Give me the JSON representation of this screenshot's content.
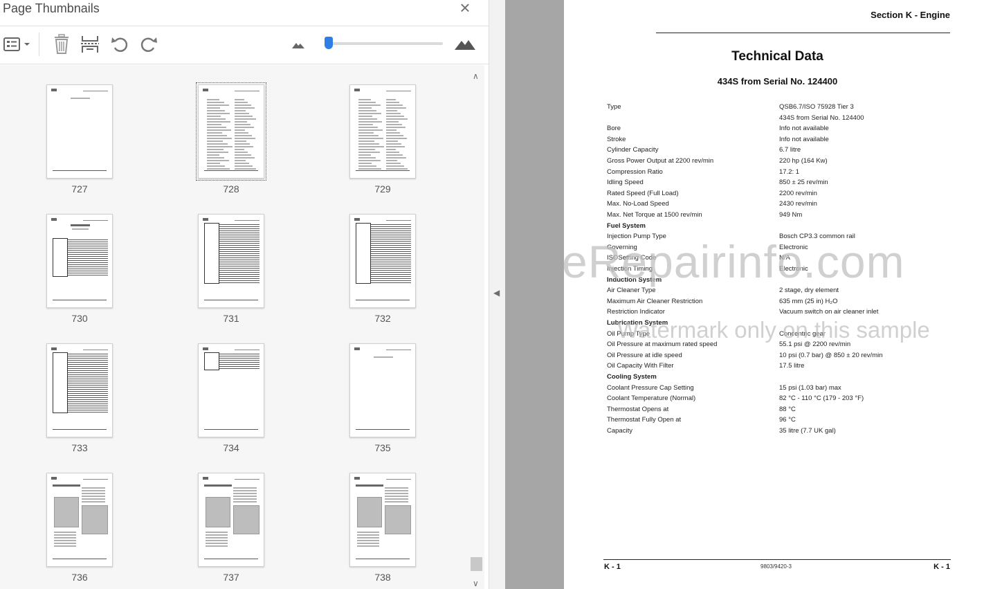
{
  "panel": {
    "title": "Page Thumbnails",
    "close_label": "×"
  },
  "toolbar": {
    "options_icon": "list-options-icon",
    "delete_icon": "trash-icon",
    "extract_icon": "page-extract-icon",
    "rotate_ccw_icon": "rotate-counterclockwise-icon",
    "rotate_cw_icon": "rotate-clockwise-icon",
    "zoom_out_icon": "mountain-small-icon",
    "zoom_in_icon": "mountain-large-icon",
    "thumbnail_size_fraction": 0.03
  },
  "thumbnails": [
    {
      "num": "727",
      "style": "blank",
      "selected": false
    },
    {
      "num": "728",
      "style": "textlist",
      "selected": true
    },
    {
      "num": "729",
      "style": "textlist",
      "selected": false
    },
    {
      "num": "730",
      "style": "table-heading",
      "selected": false
    },
    {
      "num": "731",
      "style": "table-full",
      "selected": false
    },
    {
      "num": "732",
      "style": "table-full",
      "selected": false
    },
    {
      "num": "733",
      "style": "table-full",
      "selected": false
    },
    {
      "num": "734",
      "style": "table-short",
      "selected": false
    },
    {
      "num": "735",
      "style": "blank",
      "selected": false
    },
    {
      "num": "736",
      "style": "images",
      "selected": false
    },
    {
      "num": "737",
      "style": "images",
      "selected": false
    },
    {
      "num": "738",
      "style": "images",
      "selected": false
    }
  ],
  "document": {
    "section": "Section K - Engine",
    "title": "Technical Data",
    "subtitle": "434S from Serial No. 124400",
    "rows": [
      {
        "label": "Type",
        "value": "QSB6.7/ISO 75928 Tier 3",
        "bold": false
      },
      {
        "label": "",
        "value": "434S from Serial No. 124400",
        "bold": false
      },
      {
        "label": "Bore",
        "value": "Info not available",
        "bold": false
      },
      {
        "label": "Stroke",
        "value": "Info not available",
        "bold": false
      },
      {
        "label": "Cylinder Capacity",
        "value": "6.7 litre",
        "bold": false
      },
      {
        "label": "Gross Power Output at 2200 rev/min",
        "value": "220 hp (164 Kw)",
        "bold": false
      },
      {
        "label": "Compression Ratio",
        "value": "17.2: 1",
        "bold": false
      },
      {
        "label": "Idling Speed",
        "value": "850 ± 25 rev/min",
        "bold": false
      },
      {
        "label": "Rated Speed (Full Load)",
        "value": "2200 rev/min",
        "bold": false
      },
      {
        "label": "Max. No-Load Speed",
        "value": "2430 rev/min",
        "bold": false
      },
      {
        "label": "Max. Net Torque at 1500 rev/min",
        "value": "949 Nm",
        "bold": false
      },
      {
        "label": "Fuel System",
        "value": "",
        "bold": true
      },
      {
        "label": "Injection Pump Type",
        "value": "Bosch CP3.3 common rail",
        "bold": false
      },
      {
        "label": "Governing",
        "value": "Electronic",
        "bold": false
      },
      {
        "label": "ISOSetting Code",
        "value": "N/A",
        "bold": false
      },
      {
        "label": "Injection Timing",
        "value": "Electronic",
        "bold": false
      },
      {
        "label": "Induction System",
        "value": "",
        "bold": true
      },
      {
        "label": "Air Cleaner Type",
        "value": "2 stage, dry element",
        "bold": false
      },
      {
        "label": "Maximum Air Cleaner Restriction",
        "value": "635 mm (25 in) H₂O",
        "bold": false
      },
      {
        "label": "Restriction Indicator",
        "value": "Vacuum switch on air cleaner inlet",
        "bold": false
      },
      {
        "label": "Lubrication System",
        "value": "",
        "bold": true
      },
      {
        "label": "Oil Pump Type",
        "value": "Concentric gear",
        "bold": false
      },
      {
        "label": "Oil Pressure at maximum rated speed",
        "value": "55.1 psi @ 2200 rev/min",
        "bold": false
      },
      {
        "label": "Oil Pressure at idle speed",
        "value": "10 psi (0.7 bar) @ 850 ± 20 rev/min",
        "bold": false
      },
      {
        "label": "Oil Capacity With Filter",
        "value": "17.5 litre",
        "bold": false
      },
      {
        "label": "Cooling System",
        "value": "",
        "bold": true
      },
      {
        "label": "Coolant Pressure Cap Setting",
        "value": "15 psi (1.03 bar) max",
        "bold": false
      },
      {
        "label": "Coolant Temperature (Normal)",
        "value": "82 °C - 110 °C (179 - 203 °F)",
        "bold": false
      },
      {
        "label": "Thermostat Opens at",
        "value": "88 °C",
        "bold": false
      },
      {
        "label": "Thermostat Fully Open at",
        "value": "96 °C",
        "bold": false
      },
      {
        "label": "Capacity",
        "value": "35 litre (7.7 UK gal)",
        "bold": false
      }
    ],
    "footer_left": "K - 1",
    "footer_mid": "9803/9420-3",
    "footer_right": "K - 1",
    "watermark_1": "eRepairinfo.com",
    "watermark_2": "Watermark only on this sample"
  },
  "colors": {
    "accent": "#2f7ee8",
    "gutter": "#a6a6a6"
  }
}
